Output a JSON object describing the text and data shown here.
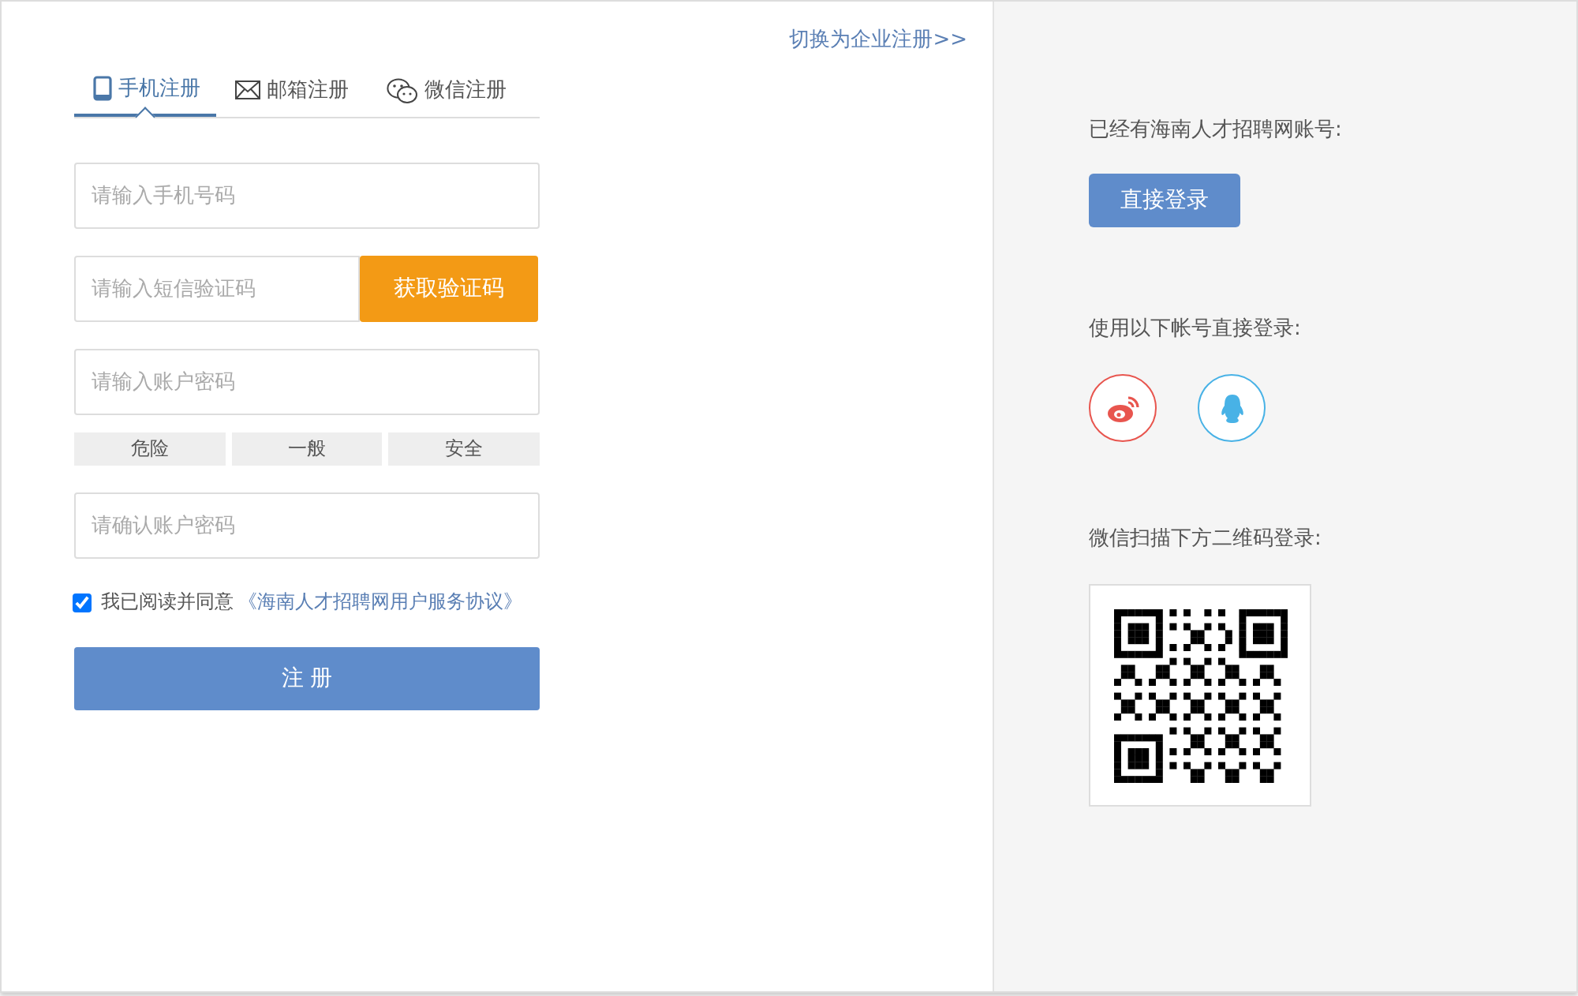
{
  "switch_link": "切换为企业注册>>",
  "tabs": [
    {
      "kind": "phone",
      "label": "手机注册",
      "selected": true
    },
    {
      "kind": "mail",
      "label": "邮箱注册",
      "selected": false
    },
    {
      "kind": "wechat",
      "label": "微信注册",
      "selected": false
    }
  ],
  "phone_field": {
    "placeholder": "请输入手机号码"
  },
  "sms_field": {
    "placeholder": "请输入短信验证码"
  },
  "sms_button": "获取验证码",
  "password_field": {
    "placeholder": "请输入账户密码"
  },
  "strength_labels": [
    "危险",
    "一般",
    "安全"
  ],
  "confirm_field": {
    "placeholder": "请确认账户密码"
  },
  "agreement": {
    "checked": true,
    "text": "我已阅读并同意",
    "link": "《海南人才招聘网用户服务协议》"
  },
  "register_button": "注 册",
  "side": {
    "have_account": "已经有海南人才招聘网账号:",
    "login_button": "直接登录",
    "social_label": "使用以下帐号直接登录:",
    "social": [
      {
        "kind": "weibo"
      },
      {
        "kind": "qq"
      }
    ],
    "qr_label": "微信扫描下方二维码登录:"
  }
}
